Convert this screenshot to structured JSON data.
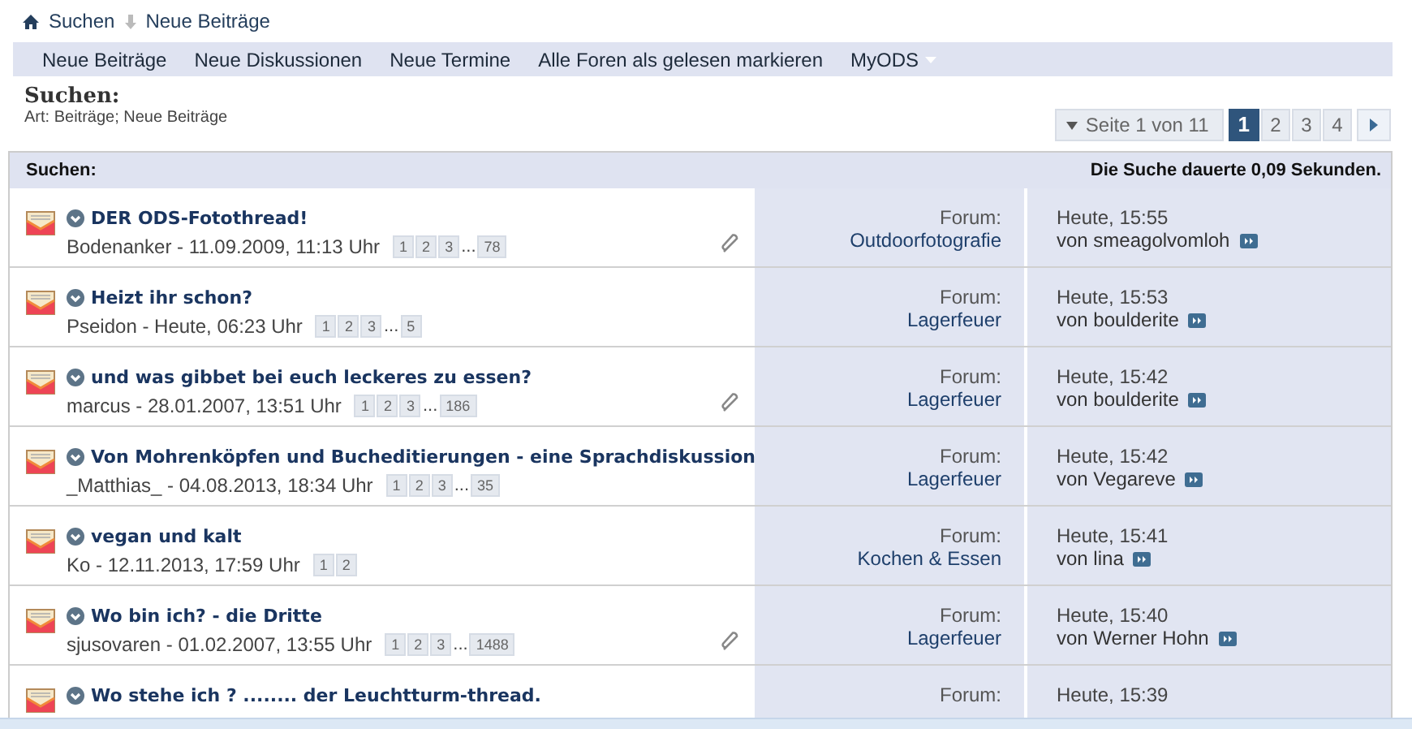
{
  "breadcrumb": [
    {
      "label": "Suchen"
    },
    {
      "label": "Neue Beiträge"
    }
  ],
  "nav": [
    {
      "label": "Neue Beiträge",
      "has_menu": false
    },
    {
      "label": "Neue Diskussionen",
      "has_menu": false
    },
    {
      "label": "Neue Termine",
      "has_menu": false
    },
    {
      "label": "Alle Foren als gelesen markieren",
      "has_menu": false
    },
    {
      "label": "MyODS",
      "has_menu": true
    }
  ],
  "heading": {
    "title": "Suchen:",
    "subtitle": "Art: Beiträge; Neue Beiträge"
  },
  "pagination": {
    "label": "Seite 1 von 11",
    "pages": [
      {
        "label": "1",
        "selected": true
      },
      {
        "label": "2",
        "selected": false
      },
      {
        "label": "3",
        "selected": false
      },
      {
        "label": "4",
        "selected": false
      }
    ]
  },
  "results": {
    "title": "Suchen:",
    "time": "Die Suche dauerte 0,09 Sekunden.",
    "rows": [
      {
        "title": "DER ODS-Fotothread!",
        "meta": "Bodenanker - 11.09.2009, 11:13 Uhr",
        "pages": [
          "1",
          "2",
          "3"
        ],
        "ellipsis": "...",
        "last_page": "78",
        "attachment": true,
        "forum_label": "Forum:",
        "forum": "Outdoorfotografie",
        "last_time": "Heute, 15:55",
        "last_by": "von smeagolvomloh"
      },
      {
        "title": "Heizt ihr schon?",
        "meta": "Pseidon - Heute, 06:23 Uhr",
        "pages": [
          "1",
          "2",
          "3"
        ],
        "ellipsis": "...",
        "last_page": "5",
        "attachment": false,
        "forum_label": "Forum:",
        "forum": "Lagerfeuer",
        "last_time": "Heute, 15:53",
        "last_by": "von boulderite"
      },
      {
        "title": "und was gibbet bei euch leckeres zu essen?",
        "meta": "marcus - 28.01.2007, 13:51 Uhr",
        "pages": [
          "1",
          "2",
          "3"
        ],
        "ellipsis": "...",
        "last_page": "186",
        "attachment": true,
        "forum_label": "Forum:",
        "forum": "Lagerfeuer",
        "last_time": "Heute, 15:42",
        "last_by": "von boulderite"
      },
      {
        "title": "Von Mohrenköpfen und Bucheditierungen - eine Sprachdiskussion",
        "meta": "_Matthias_ - 04.08.2013, 18:34 Uhr",
        "pages": [
          "1",
          "2",
          "3"
        ],
        "ellipsis": "...",
        "last_page": "35",
        "attachment": false,
        "forum_label": "Forum:",
        "forum": "Lagerfeuer",
        "last_time": "Heute, 15:42",
        "last_by": "von Vegareve"
      },
      {
        "title": "vegan und kalt",
        "meta": "Ko - 12.11.2013, 17:59 Uhr",
        "pages": [
          "1",
          "2"
        ],
        "attachment": false,
        "forum_label": "Forum:",
        "forum": "Kochen & Essen",
        "last_time": "Heute, 15:41",
        "last_by": "von lina"
      },
      {
        "title": "Wo bin ich? - die Dritte",
        "meta": "sjusovaren - 01.02.2007, 13:55 Uhr",
        "pages": [
          "1",
          "2",
          "3"
        ],
        "ellipsis": "...",
        "last_page": "1488",
        "attachment": true,
        "forum_label": "Forum:",
        "forum": "Lagerfeuer",
        "last_time": "Heute, 15:40",
        "last_by": "von Werner Hohn"
      },
      {
        "title": "Wo stehe ich ? ........ der Leuchtturm-thread.",
        "attachment": false,
        "forum_label": "Forum:",
        "last_time": "Heute, 15:39"
      }
    ]
  }
}
